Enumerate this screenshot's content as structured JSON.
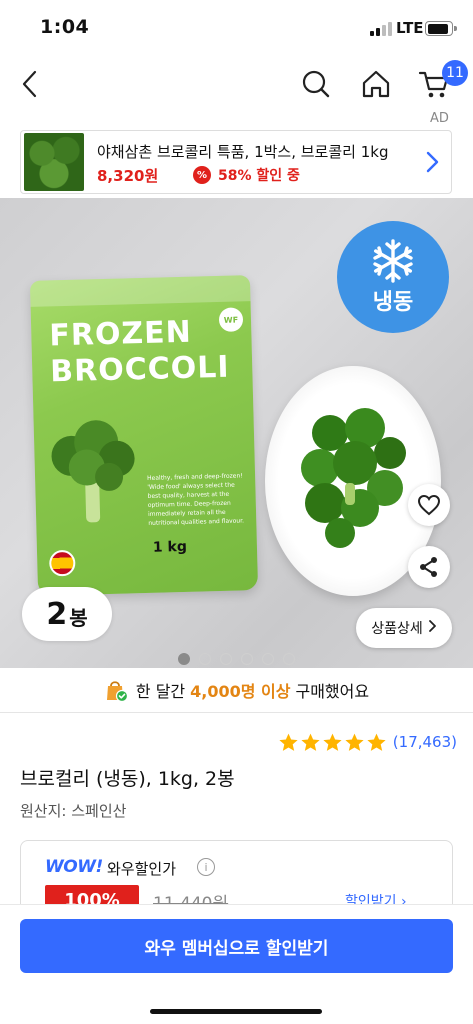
{
  "status_bar": {
    "time": "1:04",
    "network": "LTE"
  },
  "nav": {
    "cart_badge": "11"
  },
  "ad": {
    "label": "AD",
    "title": "야채삼촌 브로콜리 특품, 1박스, 브로콜리 1kg",
    "price": "8,320원",
    "discount_icon": "%",
    "discount": "58% 할인 중"
  },
  "hero": {
    "bag_title_line1": "FROZEN",
    "bag_title_line2": "BROCCOLI",
    "bag_logo": "WF",
    "bag_text": "Healthy, fresh and deep-frozen! 'Wide food' always select the best quality, harvest at the optimum time. Deep-frozen immediately retain all the nutritional qualities and flavour.",
    "bag_weight": "1 kg",
    "frozen_label": "냉동",
    "quantity_number": "2",
    "quantity_unit": "봉",
    "detail_button": "상품상세",
    "image_index": 1,
    "image_count": 6
  },
  "purchase_info": {
    "prefix": "한 달간",
    "count": "4,000명 이상",
    "suffix": "구매했어요"
  },
  "product": {
    "rating": 5,
    "review_count": "(17,463)",
    "title": "브로컬리 (냉동), 1kg, 2봉",
    "origin": "원산지: 스페인산"
  },
  "wow": {
    "logo": "WOW!",
    "label": "와우할인가",
    "discount_badge": "100%",
    "original_price": "11,440원",
    "discount_link": "할인받기"
  },
  "cta": {
    "label": "와우 멤버십으로 할인받기"
  },
  "colors": {
    "accent": "#346aff",
    "sale_red": "#e0211c",
    "star": "#ffb400",
    "frozen_badge": "#3e93e5",
    "purchase_highlight": "#e38513"
  },
  "icons": [
    "back-arrow-icon",
    "search-icon",
    "home-icon",
    "cart-icon",
    "chevron-right-icon",
    "snowflake-icon",
    "heart-icon",
    "share-icon",
    "shopping-bag-check-icon",
    "star-icon",
    "info-icon"
  ]
}
